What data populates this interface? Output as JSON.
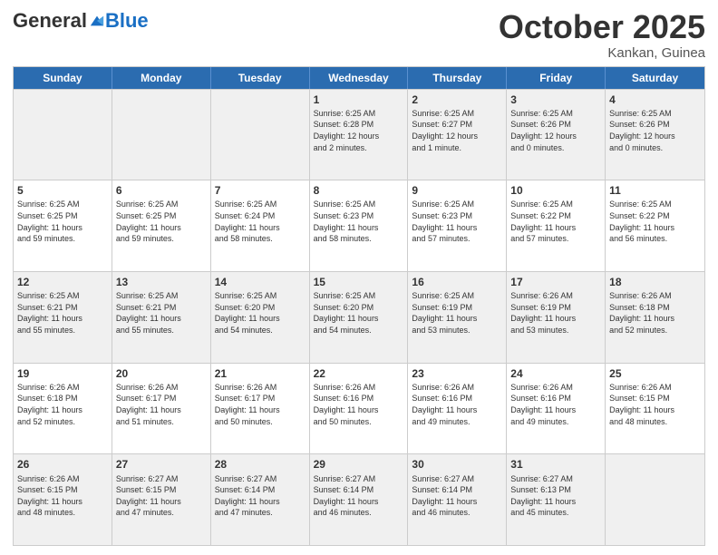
{
  "header": {
    "logo_general": "General",
    "logo_blue": "Blue",
    "month_title": "October 2025",
    "location": "Kankan, Guinea"
  },
  "days_of_week": [
    "Sunday",
    "Monday",
    "Tuesday",
    "Wednesday",
    "Thursday",
    "Friday",
    "Saturday"
  ],
  "weeks": [
    [
      {
        "day": "",
        "info": ""
      },
      {
        "day": "",
        "info": ""
      },
      {
        "day": "",
        "info": ""
      },
      {
        "day": "1",
        "info": "Sunrise: 6:25 AM\nSunset: 6:28 PM\nDaylight: 12 hours\nand 2 minutes."
      },
      {
        "day": "2",
        "info": "Sunrise: 6:25 AM\nSunset: 6:27 PM\nDaylight: 12 hours\nand 1 minute."
      },
      {
        "day": "3",
        "info": "Sunrise: 6:25 AM\nSunset: 6:26 PM\nDaylight: 12 hours\nand 0 minutes."
      },
      {
        "day": "4",
        "info": "Sunrise: 6:25 AM\nSunset: 6:26 PM\nDaylight: 12 hours\nand 0 minutes."
      }
    ],
    [
      {
        "day": "5",
        "info": "Sunrise: 6:25 AM\nSunset: 6:25 PM\nDaylight: 11 hours\nand 59 minutes."
      },
      {
        "day": "6",
        "info": "Sunrise: 6:25 AM\nSunset: 6:25 PM\nDaylight: 11 hours\nand 59 minutes."
      },
      {
        "day": "7",
        "info": "Sunrise: 6:25 AM\nSunset: 6:24 PM\nDaylight: 11 hours\nand 58 minutes."
      },
      {
        "day": "8",
        "info": "Sunrise: 6:25 AM\nSunset: 6:23 PM\nDaylight: 11 hours\nand 58 minutes."
      },
      {
        "day": "9",
        "info": "Sunrise: 6:25 AM\nSunset: 6:23 PM\nDaylight: 11 hours\nand 57 minutes."
      },
      {
        "day": "10",
        "info": "Sunrise: 6:25 AM\nSunset: 6:22 PM\nDaylight: 11 hours\nand 57 minutes."
      },
      {
        "day": "11",
        "info": "Sunrise: 6:25 AM\nSunset: 6:22 PM\nDaylight: 11 hours\nand 56 minutes."
      }
    ],
    [
      {
        "day": "12",
        "info": "Sunrise: 6:25 AM\nSunset: 6:21 PM\nDaylight: 11 hours\nand 55 minutes."
      },
      {
        "day": "13",
        "info": "Sunrise: 6:25 AM\nSunset: 6:21 PM\nDaylight: 11 hours\nand 55 minutes."
      },
      {
        "day": "14",
        "info": "Sunrise: 6:25 AM\nSunset: 6:20 PM\nDaylight: 11 hours\nand 54 minutes."
      },
      {
        "day": "15",
        "info": "Sunrise: 6:25 AM\nSunset: 6:20 PM\nDaylight: 11 hours\nand 54 minutes."
      },
      {
        "day": "16",
        "info": "Sunrise: 6:25 AM\nSunset: 6:19 PM\nDaylight: 11 hours\nand 53 minutes."
      },
      {
        "day": "17",
        "info": "Sunrise: 6:26 AM\nSunset: 6:19 PM\nDaylight: 11 hours\nand 53 minutes."
      },
      {
        "day": "18",
        "info": "Sunrise: 6:26 AM\nSunset: 6:18 PM\nDaylight: 11 hours\nand 52 minutes."
      }
    ],
    [
      {
        "day": "19",
        "info": "Sunrise: 6:26 AM\nSunset: 6:18 PM\nDaylight: 11 hours\nand 52 minutes."
      },
      {
        "day": "20",
        "info": "Sunrise: 6:26 AM\nSunset: 6:17 PM\nDaylight: 11 hours\nand 51 minutes."
      },
      {
        "day": "21",
        "info": "Sunrise: 6:26 AM\nSunset: 6:17 PM\nDaylight: 11 hours\nand 50 minutes."
      },
      {
        "day": "22",
        "info": "Sunrise: 6:26 AM\nSunset: 6:16 PM\nDaylight: 11 hours\nand 50 minutes."
      },
      {
        "day": "23",
        "info": "Sunrise: 6:26 AM\nSunset: 6:16 PM\nDaylight: 11 hours\nand 49 minutes."
      },
      {
        "day": "24",
        "info": "Sunrise: 6:26 AM\nSunset: 6:16 PM\nDaylight: 11 hours\nand 49 minutes."
      },
      {
        "day": "25",
        "info": "Sunrise: 6:26 AM\nSunset: 6:15 PM\nDaylight: 11 hours\nand 48 minutes."
      }
    ],
    [
      {
        "day": "26",
        "info": "Sunrise: 6:26 AM\nSunset: 6:15 PM\nDaylight: 11 hours\nand 48 minutes."
      },
      {
        "day": "27",
        "info": "Sunrise: 6:27 AM\nSunset: 6:15 PM\nDaylight: 11 hours\nand 47 minutes."
      },
      {
        "day": "28",
        "info": "Sunrise: 6:27 AM\nSunset: 6:14 PM\nDaylight: 11 hours\nand 47 minutes."
      },
      {
        "day": "29",
        "info": "Sunrise: 6:27 AM\nSunset: 6:14 PM\nDaylight: 11 hours\nand 46 minutes."
      },
      {
        "day": "30",
        "info": "Sunrise: 6:27 AM\nSunset: 6:14 PM\nDaylight: 11 hours\nand 46 minutes."
      },
      {
        "day": "31",
        "info": "Sunrise: 6:27 AM\nSunset: 6:13 PM\nDaylight: 11 hours\nand 45 minutes."
      },
      {
        "day": "",
        "info": ""
      }
    ]
  ]
}
